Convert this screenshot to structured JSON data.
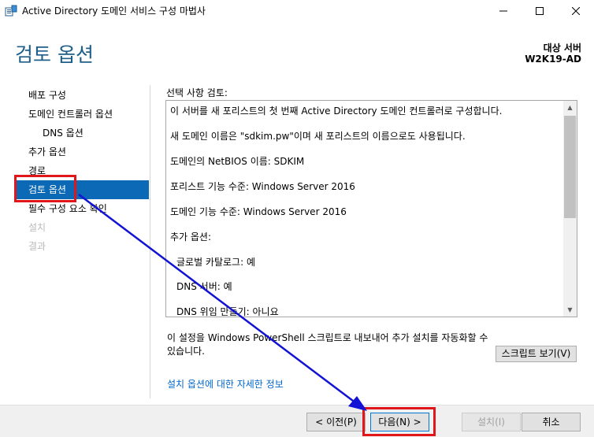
{
  "window": {
    "title": "Active Directory 도메인 서비스 구성 마법사",
    "minimize_icon": "minimize-icon",
    "maximize_icon": "maximize-icon",
    "close_icon": "close-icon"
  },
  "header": {
    "page_title": "검토 옵션",
    "target_label": "대상 서버",
    "target_server": "W2K19-AD"
  },
  "nav": {
    "items": [
      {
        "label": "배포 구성",
        "state": "normal"
      },
      {
        "label": "도메인 컨트롤러 옵션",
        "state": "normal"
      },
      {
        "label": "DNS 옵션",
        "state": "sub"
      },
      {
        "label": "추가 옵션",
        "state": "normal"
      },
      {
        "label": "경로",
        "state": "normal"
      },
      {
        "label": "검토 옵션",
        "state": "active"
      },
      {
        "label": "필수 구성 요소 확인",
        "state": "normal"
      },
      {
        "label": "설치",
        "state": "disabled"
      },
      {
        "label": "결과",
        "state": "disabled"
      }
    ]
  },
  "review": {
    "label": "선택 사항 검토:",
    "lines": [
      "이 서버를 새 포리스트의 첫 번째 Active Directory 도메인 컨트롤러로 구성합니다.",
      "새 도메인 이름은 \"sdkim.pw\"이며 새 포리스트의 이름으로도 사용됩니다.",
      "도메인의 NetBIOS 이름: SDKIM",
      "포리스트 기능 수준: Windows Server 2016",
      "도메인 기능 수준: Windows Server 2016",
      "추가 옵션:",
      "글로벌 카탈로그: 예",
      "DNS 서버: 예",
      "DNS 위임 만들기: 아니요"
    ]
  },
  "export_text": "이 설정을 Windows PowerShell 스크립트로 내보내어 추가 설치를 자동화할 수 있습니다.",
  "view_script_label": "스크립트 보기(V)",
  "more_info_link": "설치 옵션에 대한 자세한 정보",
  "footer": {
    "previous_label": "< 이전(P)",
    "next_label": "다음(N) >",
    "install_label": "설치(I)",
    "cancel_label": "취소"
  },
  "colors": {
    "title_blue": "#1d5f8a",
    "nav_active": "#0c69b5",
    "annotation_red": "#e0161b",
    "annotation_arrow": "#1313d6",
    "link": "#0066cc"
  }
}
